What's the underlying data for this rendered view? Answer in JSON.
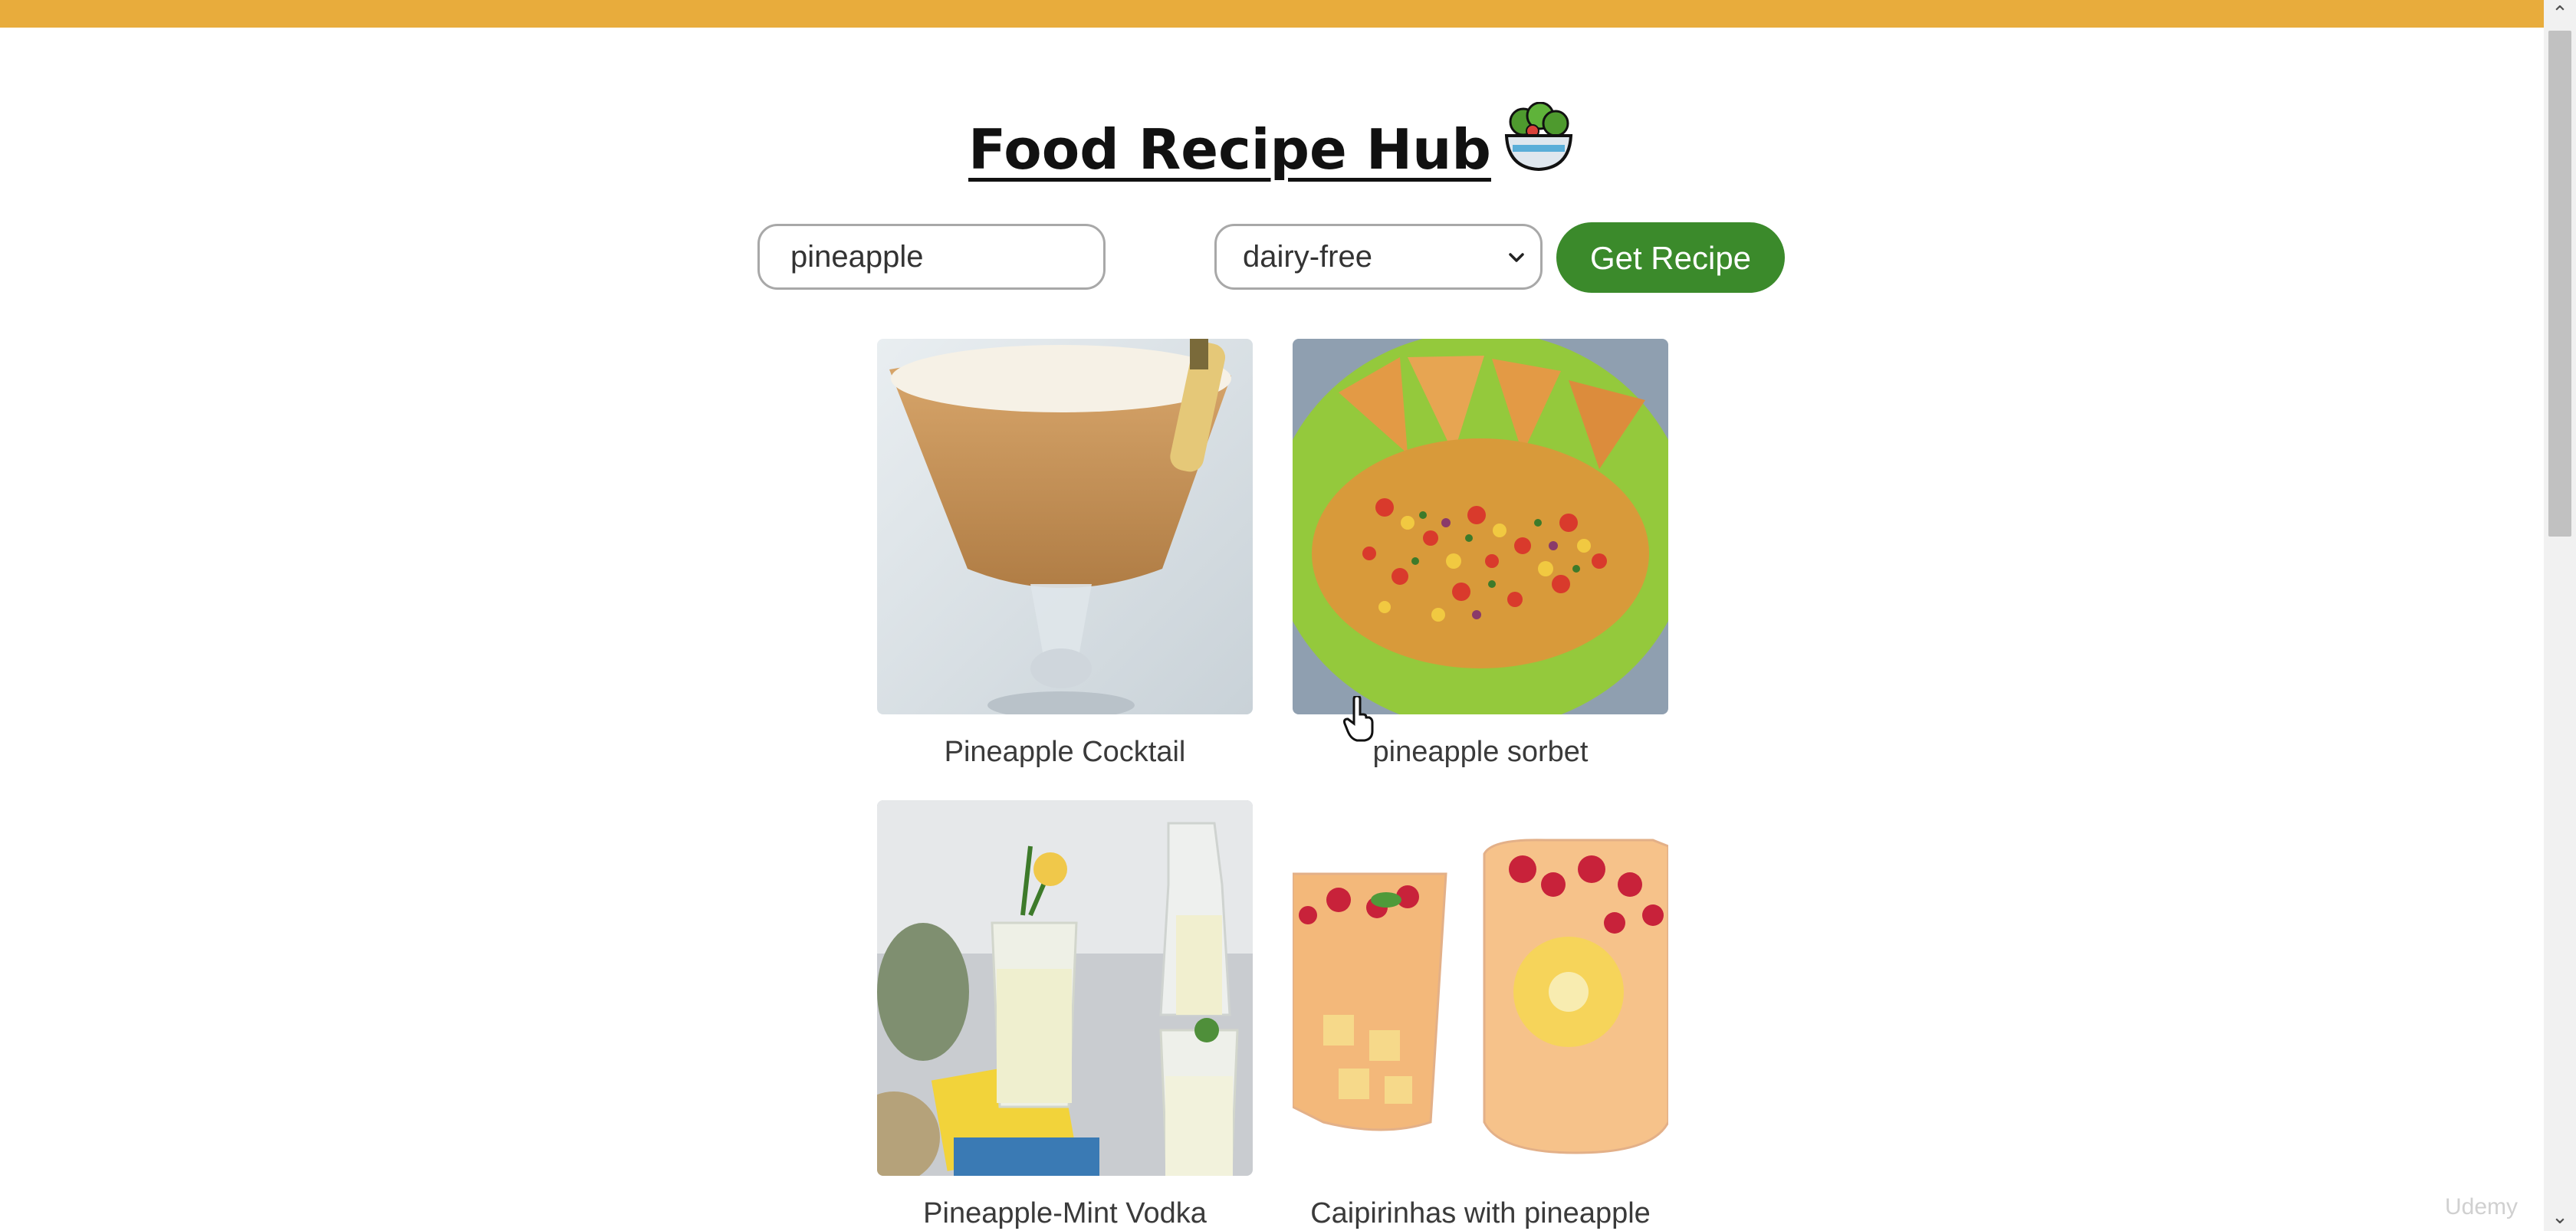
{
  "header": {
    "title": "Food Recipe Hub",
    "icon": "salad-bowl-icon"
  },
  "search": {
    "value": "pineapple",
    "placeholder": ""
  },
  "diet_filter": {
    "selected": "dairy-free"
  },
  "button": {
    "label": "Get Recipe"
  },
  "recipes": [
    {
      "name": "Pineapple Cocktail",
      "image": "cocktail-glass-image"
    },
    {
      "name": "pineapple sorbet",
      "image": "salsa-bowl-image"
    },
    {
      "name": "Pineapple-Mint Vodka",
      "image": "vodka-glasses-image"
    },
    {
      "name": "Caipirinhas with pineapple",
      "image": "pineapple-jar-image"
    }
  ],
  "watermark": "Udemy",
  "colors": {
    "top_bar": "#e8ac3c",
    "button": "#3b8a2b"
  }
}
